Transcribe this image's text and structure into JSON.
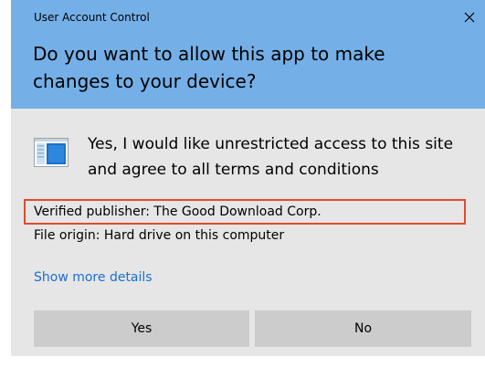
{
  "window": {
    "title": "User Account Control",
    "close_icon": "close-icon"
  },
  "prompt": {
    "question": "Do you want to allow this app to make changes to your device?"
  },
  "app": {
    "icon": "application-window-icon",
    "name": "Yes, I would like unrestricted access to this site and agree to all terms and conditions"
  },
  "details": {
    "publisher": "Verified publisher: The Good Download Corp.",
    "origin": "File origin: Hard drive on this computer",
    "show_more": "Show more details"
  },
  "buttons": {
    "yes": "Yes",
    "no": "No"
  },
  "colors": {
    "header_background": "#74b0e7",
    "dialog_background": "#e6e6e6",
    "button_background": "#cccccc",
    "link": "#1a6fd1",
    "highlight_border": "#e04a2e"
  }
}
